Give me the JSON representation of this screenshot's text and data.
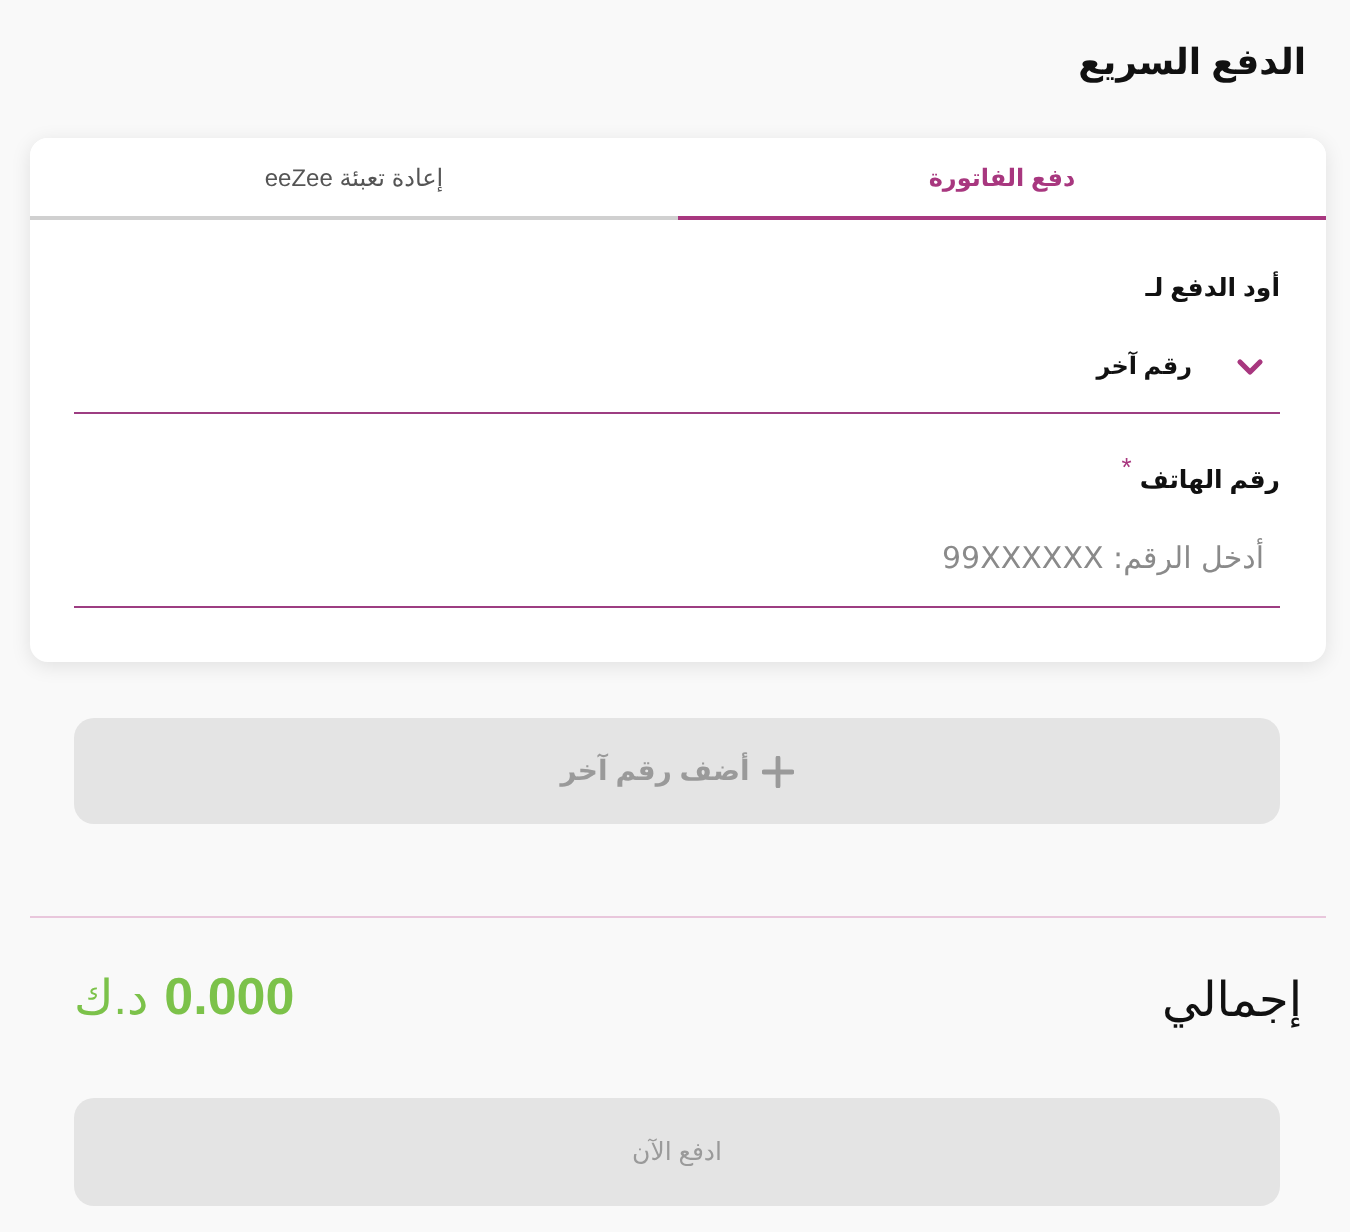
{
  "page_title": "الدفع السريع",
  "tabs": [
    {
      "label": "دفع الفاتورة",
      "selected": true
    },
    {
      "label": "إعادة تعبئة eeZee",
      "selected": false
    }
  ],
  "pay_for": {
    "label": "أود الدفع لـ",
    "value": "رقم آخر"
  },
  "phone": {
    "label": "رقم الهاتف",
    "required_mark": "*",
    "placeholder": "أدخل الرقم: 99XXXXXX"
  },
  "add_number_button": {
    "label": "أضف رقم آخر",
    "disabled": true
  },
  "total": {
    "label": "إجمالي",
    "amount": "0.000",
    "currency": "د.ك"
  },
  "pay_button": {
    "label": "ادفع الآن",
    "disabled": true
  }
}
